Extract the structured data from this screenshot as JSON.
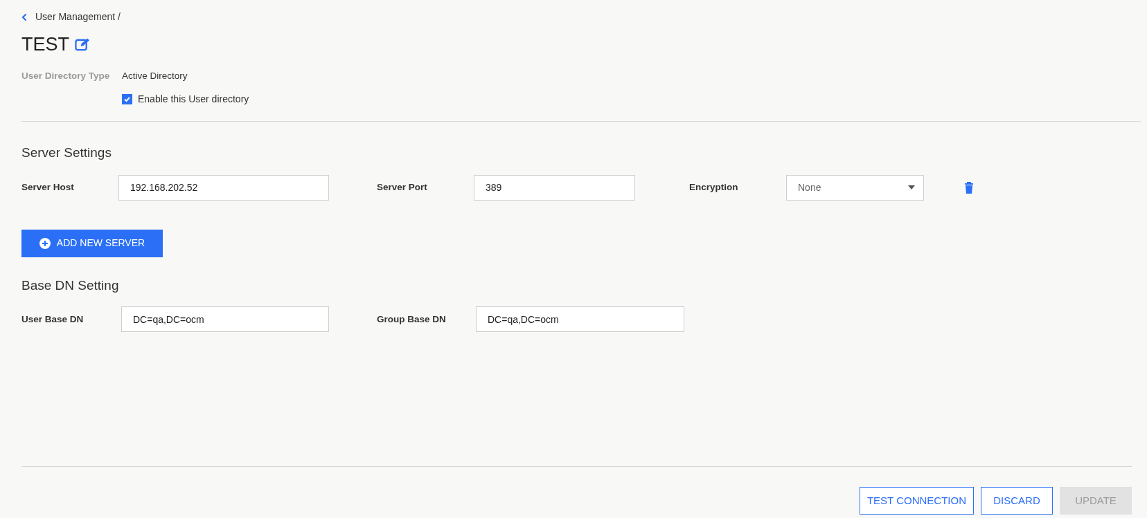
{
  "breadcrumb": {
    "label": "User Management /"
  },
  "title": "TEST",
  "directory": {
    "label": "User Directory Type",
    "value": "Active Directory",
    "enable": {
      "label": "Enable this User directory",
      "checked": true
    }
  },
  "server_settings": {
    "heading": "Server Settings",
    "servers": [
      {
        "host_label": "Server Host",
        "host": "192.168.202.52",
        "port_label": "Server Port",
        "port": "389",
        "encryption_label": "Encryption",
        "encryption": "None"
      }
    ],
    "add_button": "ADD NEW SERVER"
  },
  "base_dn": {
    "heading": "Base DN Setting",
    "user_label": "User Base DN",
    "user_value": "DC=qa,DC=ocm",
    "group_label": "Group Base DN",
    "group_value": "DC=qa,DC=ocm"
  },
  "actions": [
    {
      "label": "TEST CONNECTION",
      "disabled": false
    },
    {
      "label": "DISCARD",
      "disabled": false
    },
    {
      "label": "UPDATE",
      "disabled": true
    }
  ]
}
